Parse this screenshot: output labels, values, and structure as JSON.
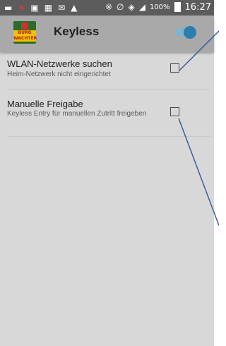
{
  "status_bar": {
    "battery_text": "100%",
    "time": "16:27"
  },
  "app_bar": {
    "logo_text_top": "BURG",
    "logo_text_bottom": "WACHTER",
    "title": "Keyless",
    "toggle_state": "on"
  },
  "settings": [
    {
      "title": "WLAN-Netzwerke suchen",
      "summary": "Heim-Netzwerk nicht eingerichtet",
      "checked": false
    },
    {
      "title": "Manuelle Freigabe",
      "summary": "Keyless Entry für manuellen Zutritt freigeben",
      "checked": false
    }
  ],
  "colors": {
    "status_bar": "#5c5c5c",
    "app_bar": "#a9a9a9",
    "background": "#d8d8d8",
    "toggle_accent": "#2a7fae",
    "callout_line": "#2c5a9a"
  }
}
